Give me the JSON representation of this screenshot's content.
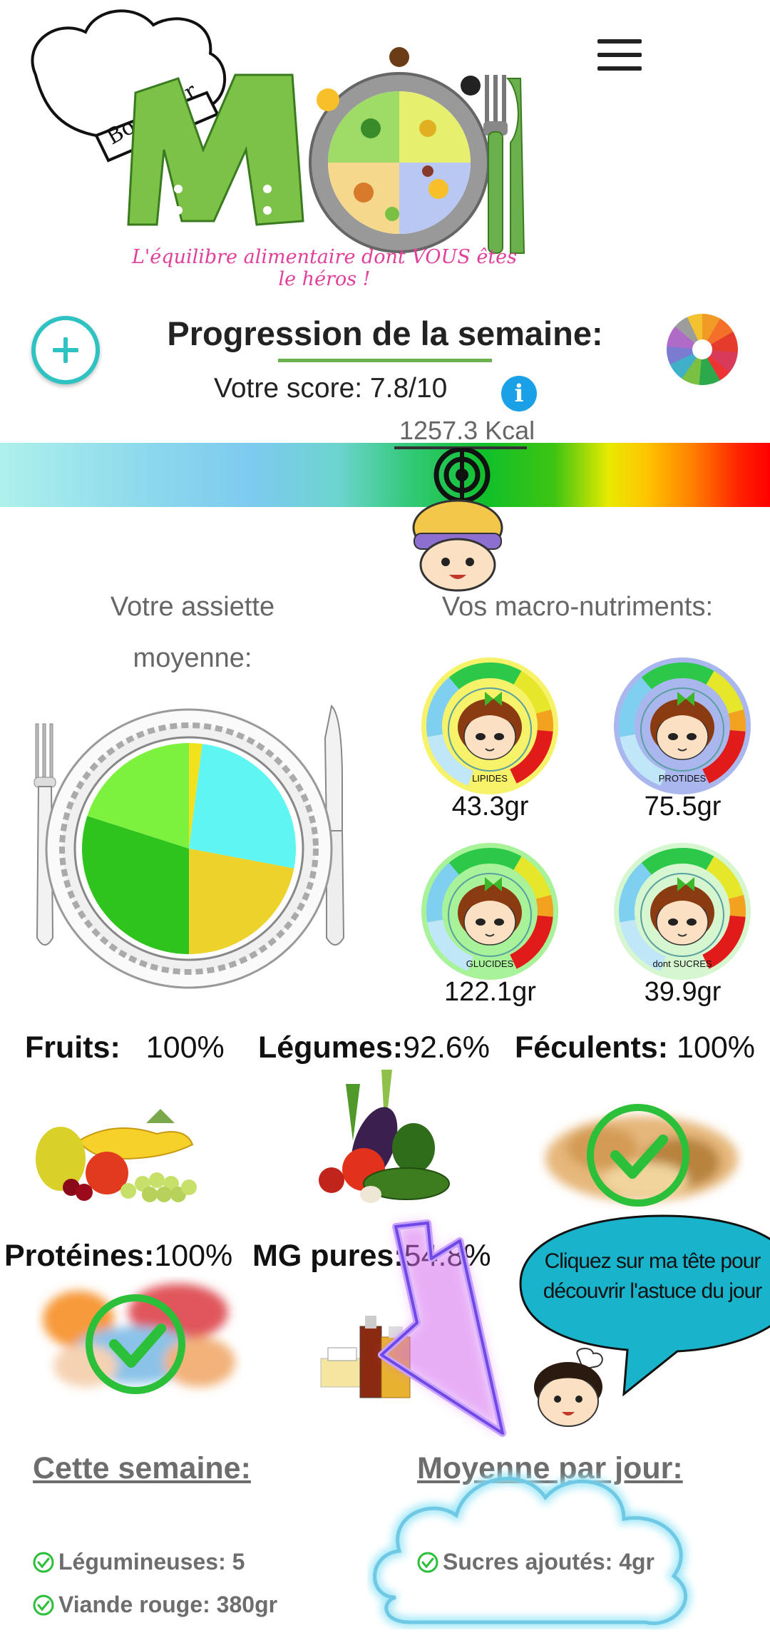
{
  "header": {
    "logo_text": "Bon pour MOI",
    "tagline": "L'équilibre alimentaire dont VOUS êtes le héros !"
  },
  "progress": {
    "title": "Progression de la semaine:",
    "score_label": "Votre score: 7.8/10",
    "kcal": "1257.3 Kcal",
    "gauge_position_percent": 62
  },
  "plate": {
    "title_line1": "Votre assiette",
    "title_line2": "moyenne:"
  },
  "chart_data": {
    "type": "pie",
    "slices": [
      {
        "color": "#f2e21e",
        "value": 2
      },
      {
        "color": "#5ff5f2",
        "value": 26
      },
      {
        "color": "#ecd22a",
        "value": 22
      },
      {
        "color": "#2fc31d",
        "value": 30
      },
      {
        "color": "#7cf23e",
        "value": 20
      }
    ]
  },
  "macros": {
    "title": "Vos macro-nutriments:",
    "items": [
      {
        "label": "LIPIDES",
        "value": "43.3gr",
        "bg": "#f6f26a"
      },
      {
        "label": "PROTIDES",
        "value": "75.5gr",
        "bg": "#a9b7ee"
      },
      {
        "label": "GLUCIDES",
        "value": "122.1gr",
        "bg": "#a8f29a"
      },
      {
        "label": "dont SUCRES",
        "value": "39.9gr",
        "bg": "#d6f6d0"
      }
    ]
  },
  "categories": {
    "fruits": {
      "label": "Fruits:",
      "value": "100%"
    },
    "legumes": {
      "label": "Légumes:",
      "value": "92.6%"
    },
    "feculents": {
      "label": "Féculents:",
      "value": "100%"
    },
    "proteines": {
      "label": "Protéines:",
      "value": "100%"
    },
    "mg": {
      "label": "MG pures:",
      "value": "54.8%"
    }
  },
  "tip": {
    "line1": "Cliquez sur ma tête pour",
    "line2": "découvrir l'astuce du jour"
  },
  "week": {
    "title": "Cette semaine:",
    "items": [
      {
        "label": "Légumineuses: 5"
      },
      {
        "label": "Viande rouge: 380gr"
      }
    ]
  },
  "daily": {
    "title": "Moyenne par jour:",
    "items": [
      {
        "label": "Sucres ajoutés: 4gr"
      }
    ]
  },
  "colors": {
    "accent_green": "#6ab04c",
    "teal": "#2fc2c2",
    "info_blue": "#1aa0e6",
    "check_green": "#2bbf3a",
    "bubble_blue": "#19b3cc"
  }
}
